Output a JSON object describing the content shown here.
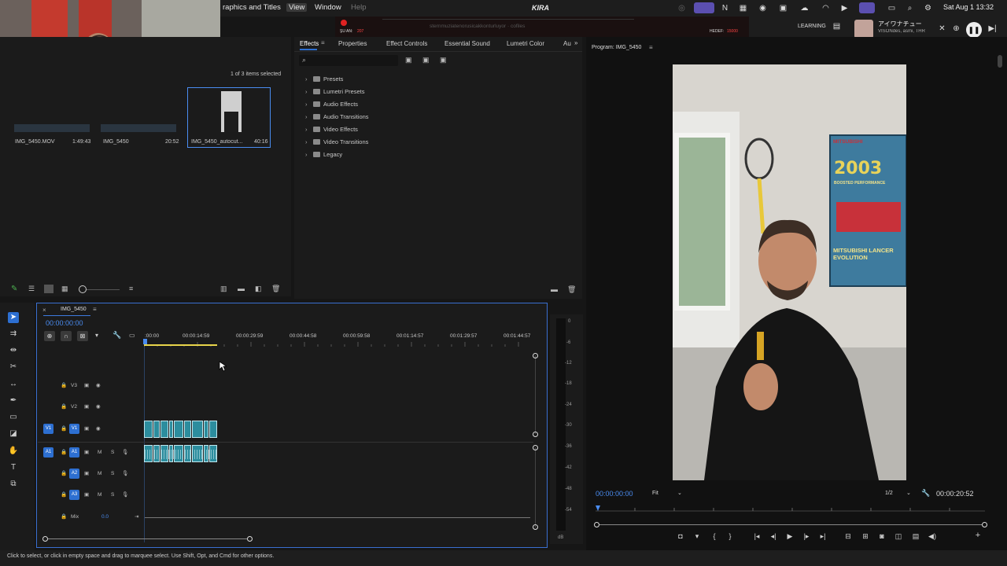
{
  "menubar": {
    "items": [
      "raphics and Titles",
      "View",
      "Window",
      "Help"
    ],
    "kira": "KIRA",
    "clock": "Sat Aug 1  13:32",
    "stream": {
      "su_an_label": "ŞU AN:",
      "su_an_value": "207",
      "hedef_label": "HEDEF:",
      "hedef_value": "15000",
      "marquee": "sternmuziatenorusicakkonturluyor · cofiles"
    },
    "now_playing": {
      "title": "アイワナチュー",
      "artist": "VISONdes, asmi, THR"
    }
  },
  "workspace": {
    "label": "LEARNING"
  },
  "project": {
    "selection_info": "1 of 3 items selected",
    "items": [
      {
        "name": "IMG_5450.MOV",
        "duration": "1:49:43"
      },
      {
        "name": "IMG_5450",
        "duration": "20:52"
      },
      {
        "name": "IMG_5450_autocut...",
        "duration": "40:16"
      }
    ]
  },
  "effects": {
    "tabs": [
      "Effects",
      "Properties",
      "Effect Controls",
      "Essential Sound",
      "Lumetri Color",
      "Au"
    ],
    "tree": [
      "Presets",
      "Lumetri Presets",
      "Audio Effects",
      "Audio Transitions",
      "Video Effects",
      "Video Transitions",
      "Legacy"
    ]
  },
  "program": {
    "title": "Program: IMG_5450",
    "timecode": "00:00:00:00",
    "fit": "Fit",
    "resolution": "1/2",
    "duration": "00:00:20:52",
    "poster": {
      "year": "2003",
      "brand": "MITSUBISHI",
      "tagline": "BOOSTED PERFORMANCE",
      "model": "MITSUBISHI LANCER EVOLUTION"
    }
  },
  "timeline": {
    "sequence": "IMG_5450",
    "timecode": "00:00:00:00",
    "ticks": [
      ":00:00",
      "00:00:14:59",
      "00:00:29:59",
      "00:00:44:58",
      "00:00:59:58",
      "00:01:14:57",
      "00:01:29:57",
      "00:01:44:57"
    ],
    "tracks": {
      "v3": "V3",
      "v2": "V2",
      "v1": "V1",
      "v1_src": "V1",
      "a1": "A1",
      "a1_src": "A1",
      "a2": "A2",
      "a3": "A3",
      "mix": "Mix",
      "mix_value": "0.0",
      "m": "M",
      "s": "S"
    },
    "meter_labels": [
      "0",
      "-6",
      "-12",
      "-18",
      "-24",
      "-30",
      "-36",
      "-42",
      "-48",
      "-54",
      "dB"
    ]
  },
  "status": {
    "text": "Click to select, or click in empty space and drag to marquee select. Use Shift, Opt, and Cmd for other options."
  },
  "colors": {
    "accent": "#2d6fd1",
    "clip": "#2c8d9e",
    "playhead": "#e8d44a"
  }
}
